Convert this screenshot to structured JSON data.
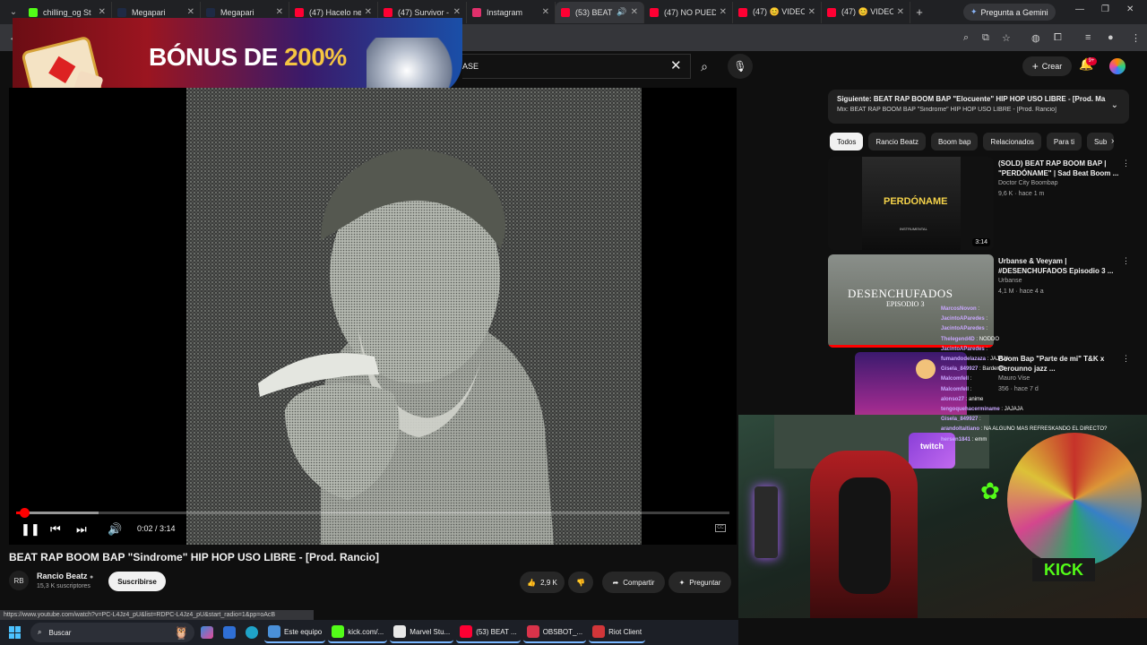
{
  "browser": {
    "tabs": [
      {
        "label": "chilling_og St",
        "fav": "#53fc18",
        "icon": "kick-icon"
      },
      {
        "label": "Megapari",
        "fav": "#1e2a44",
        "icon": "megapari-icon"
      },
      {
        "label": "Megapari",
        "fav": "#1e2a44",
        "icon": "megapari-icon"
      },
      {
        "label": "(47) Hacelo ne",
        "fav": "#ff0033",
        "icon": "youtube-icon"
      },
      {
        "label": "(47) Survivor -",
        "fav": "#ff0033",
        "icon": "youtube-icon"
      },
      {
        "label": "Instagram",
        "fav": "#e1306c",
        "icon": "instagram-icon"
      },
      {
        "label": "(53) BEAT",
        "fav": "#ff0033",
        "icon": "youtube-icon",
        "active": true
      },
      {
        "label": "(47) NO PUED",
        "fav": "#ff0033",
        "icon": "youtube-icon"
      },
      {
        "label": "(47) 😊 VIDEO",
        "fav": "#ff0033",
        "icon": "youtube-icon"
      },
      {
        "label": "(47) 😊 VIDEO",
        "fav": "#ff0033",
        "icon": "youtube-icon"
      }
    ],
    "new_tab": "+",
    "gemini_label": "Pregunta a Gemini",
    "status_url": "https://www.youtube.com/watch?v=PC-L4Jz4_pU&list=RDPC-L4Jz4_pU&start_radio=1&pp=oAcB"
  },
  "ad_banner": {
    "text_main": "BÓNUS DE ",
    "text_gold": "200%"
  },
  "youtube": {
    "search_value": "ASE",
    "create_label": "Crear",
    "notif_count": "9+",
    "player": {
      "time": "0:02 / 3:14",
      "progress_fraction": 0.011,
      "buffered_fraction": 0.115
    },
    "video_title": "BEAT RAP BOOM BAP \"Sindrome\" HIP HOP USO LIBRE - [Prod. Rancio]",
    "channel": {
      "name": "Rancio Beatz",
      "subs": "15,3 K suscriptores",
      "logo": "RB"
    },
    "subscribe_label": "Suscribirse",
    "likes": "2,9 K",
    "share_label": "Compartir",
    "ask_label": "Preguntar",
    "next_up": {
      "line1": "Siguiente: BEAT RAP BOOM BAP \"Elocuente\" HIP HOP USO LIBRE - [Prod. Ma...",
      "line2": "Mix: BEAT RAP BOOM BAP \"Sindrome\" HIP HOP USO LIBRE - [Prod. Rancio]"
    },
    "chips": [
      "Todos",
      "Rancio Beatz",
      "Boom bap",
      "Relacionados",
      "Para ti",
      "Sub"
    ],
    "recommendations": [
      {
        "title": "(SOLD) BEAT RAP BOOM BAP | \"PERDÓNAME\" | Sad Beat Boom ...",
        "channel": "Doctor City Boombap",
        "meta": "9,6 K · hace 1 m",
        "duration": "3:14",
        "thumb_text": "PERDÓNAME",
        "thumb_sub": "INSTRUMENTAL"
      },
      {
        "title": "Urbanse & Veeyam | #DESENCHUFADOS Episodio 3 ...",
        "channel": "Urbanse",
        "meta": "4,1 M · hace 4 a",
        "thumb_text": "DESENCHUFADOS",
        "thumb_sub": "EPISODIO 3"
      },
      {
        "title": "Boom Bap \"Parte de mi\" T&K x Cerounno jazz ...",
        "channel": "Mauro Vise",
        "meta": "356 · hace 7 d"
      }
    ]
  },
  "stream_overlay": {
    "chat": [
      {
        "user": "MarcosNovon",
        "msg": ":"
      },
      {
        "user": "JacintoAParedes",
        "msg": ":"
      },
      {
        "user": "JacintoAParedes",
        "msg": ":"
      },
      {
        "user": "Thelegend4D",
        "msg": ": NODDO"
      },
      {
        "user": "JacintoAParedes",
        "msg": ":"
      },
      {
        "user": "fumandodelazaza",
        "msg": ": JAJAJA"
      },
      {
        "user": "Gisela_849927",
        "msg": ": Barder98"
      },
      {
        "user": "Malcomfell",
        "msg": ":"
      },
      {
        "user": "Malcomfell",
        "msg": ":"
      },
      {
        "user": "alonso27",
        "msg": ": anime"
      },
      {
        "user": "tengoquehacerminame",
        "msg": ": JAJAJA"
      },
      {
        "user": "Gisela_849927",
        "msg": ":"
      },
      {
        "user": "arandoltaitiano",
        "msg": ": NA ALGUNO MAS REFRESKANDO EL DIRECTO?"
      },
      {
        "user": "hersen1841",
        "msg": ": emm"
      }
    ],
    "twitch_label": "twitch",
    "kick_label": "KICK"
  },
  "taskbar": {
    "search_placeholder": "Buscar",
    "apps": [
      {
        "label": "Este equipo",
        "color": "#4a90d9"
      },
      {
        "label": "kick.com/...",
        "color": "#53fc18"
      },
      {
        "label": "Marvel Stu...",
        "color": "#e8e8e8"
      },
      {
        "label": "(53) BEAT ...",
        "color": "#ff0033"
      },
      {
        "label": "OBSBOT_...",
        "color": "#d8334a"
      },
      {
        "label": "Riot Client",
        "color": "#d13639"
      }
    ]
  }
}
